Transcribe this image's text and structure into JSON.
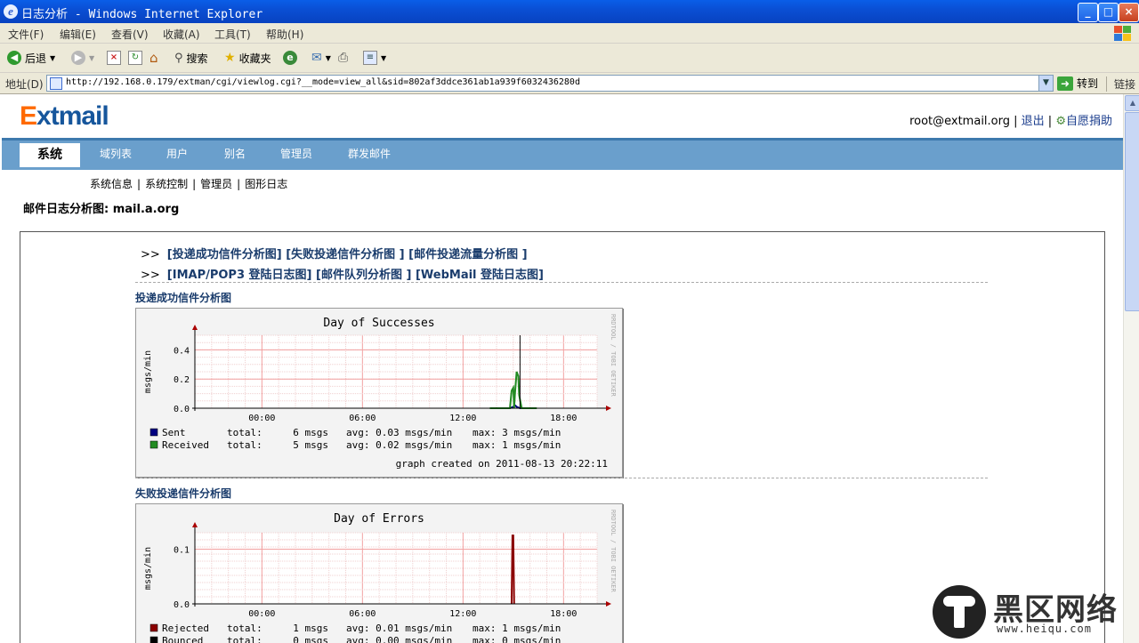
{
  "window": {
    "title": "日志分析 - Windows Internet Explorer",
    "controls": [
      "_",
      "□",
      "×"
    ]
  },
  "menu": [
    "文件(F)",
    "编辑(E)",
    "查看(V)",
    "收藏(A)",
    "工具(T)",
    "帮助(H)"
  ],
  "toolbar": {
    "back": "后退",
    "search": "搜索",
    "favorites": "收藏夹"
  },
  "address": {
    "label": "地址(D)",
    "url": "http://192.168.0.179/extman/cgi/viewlog.cgi?__mode=view_all&sid=802af3ddce361ab1a939f6032436280d",
    "go": "转到",
    "links": "链接"
  },
  "page": {
    "logo_e": "E",
    "logo_rest": "xtmail",
    "user": "root@extmail.org",
    "logout": "退出",
    "donate": "自愿捐助",
    "nav": [
      "系统",
      "域列表",
      "用户",
      "别名",
      "管理员",
      "群发邮件"
    ],
    "subnav": [
      "系统信息",
      "系统控制",
      "管理员",
      "图形日志"
    ],
    "heading": "邮件日志分析图: mail.a.org",
    "links_row1": [
      "[投递成功信件分析图]",
      "[失败投递信件分析图 ]",
      "[邮件投递流量分析图 ]"
    ],
    "links_row2": [
      "[IMAP/POP3 登陆日志图]",
      "[邮件队列分析图 ]",
      "[WebMail 登陆日志图]"
    ],
    "section1": "投递成功信件分析图",
    "section2": "失败投递信件分析图"
  },
  "chart_data": [
    {
      "type": "line",
      "title": "Day of Successes",
      "ylabel": "msgs/min",
      "side_label": "RRDTOOL / TOBI OETIKER",
      "x_ticks": [
        "00:00",
        "06:00",
        "12:00",
        "18:00"
      ],
      "y_ticks": [
        "0.0",
        "0.2",
        "0.4"
      ],
      "ylim": [
        0,
        0.5
      ],
      "xlim_hours": [
        -4,
        20
      ],
      "series": [
        {
          "name": "Sent",
          "color": "#000080",
          "x": [
            14.0,
            14.8,
            15.0,
            15.1,
            15.2,
            15.4,
            16.0
          ],
          "values": [
            0,
            0,
            0.01,
            0.02,
            0.01,
            0,
            0
          ]
        },
        {
          "name": "Received",
          "color": "#228b22",
          "x": [
            13.6,
            14.8,
            14.9,
            15.0,
            15.05,
            15.1,
            15.2,
            15.3,
            15.35,
            15.45,
            15.5,
            16.0,
            16.4
          ],
          "values": [
            0,
            0,
            0.12,
            0.14,
            0,
            0.1,
            0.25,
            0.22,
            0.09,
            0.03,
            0,
            0,
            0
          ]
        }
      ],
      "now_marker_hour": 15.4,
      "legend": [
        {
          "name": "Sent",
          "total": "total:",
          "total_val": "6 msgs",
          "avg": "avg: 0.03 msgs/min",
          "max": "max: 3 msgs/min"
        },
        {
          "name": "Received",
          "total": "total:",
          "total_val": "5 msgs",
          "avg": "avg: 0.02 msgs/min",
          "max": "max: 1 msgs/min"
        }
      ],
      "footer": "graph created on 2011-08-13 20:22:11"
    },
    {
      "type": "line",
      "title": "Day of Errors",
      "ylabel": "msgs/min",
      "side_label": "RRDTOOL / TOBI OETIKER",
      "x_ticks": [
        "00:00",
        "06:00",
        "12:00",
        "18:00"
      ],
      "y_ticks": [
        "0.0",
        "0.1"
      ],
      "ylim": [
        0,
        0.13
      ],
      "xlim_hours": [
        -4,
        20
      ],
      "series": [
        {
          "name": "Rejected",
          "color": "#8b0000",
          "x": [
            14.9,
            14.95,
            15.0,
            15.05
          ],
          "values": [
            0,
            0.125,
            0.125,
            0
          ]
        },
        {
          "name": "Bounced",
          "color": "#000000",
          "x": [],
          "values": []
        }
      ],
      "legend": [
        {
          "name": "Rejected",
          "total": "total:",
          "total_val": "1 msgs",
          "avg": "avg: 0.01 msgs/min",
          "max": "max: 1 msgs/min"
        },
        {
          "name": "Bounced",
          "total": "total:",
          "total_val": "0 msgs",
          "avg": "avg: 0.00 msgs/min",
          "max": "max: 0 msgs/min"
        }
      ]
    }
  ],
  "watermark": {
    "text": "黑区网络",
    "site": "www.heiqu.com"
  }
}
